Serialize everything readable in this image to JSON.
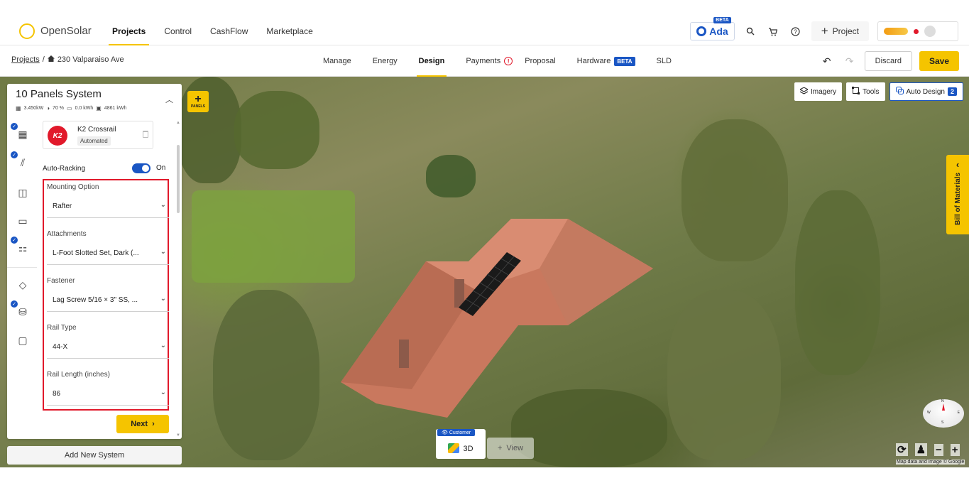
{
  "app": {
    "logo_text": "OpenSolar"
  },
  "topnav": {
    "items": [
      "Projects",
      "Control",
      "CashFlow",
      "Marketplace"
    ],
    "ada_label": "Ada",
    "ada_badge": "BETA",
    "project_button": "Project"
  },
  "subbar": {
    "breadcrumb_root": "Projects",
    "breadcrumb_separator": "/",
    "breadcrumb_project": "230 Valparaiso Ave",
    "tabs": [
      "Manage",
      "Energy",
      "Design",
      "Payments",
      "Proposal",
      "Hardware",
      "SLD"
    ],
    "hardware_badge": "BETA",
    "discard": "Discard",
    "save": "Save"
  },
  "system": {
    "title": "10 Panels System",
    "kw": "3.450",
    "kw_unit": "kW",
    "offset": "70",
    "offset_unit": "%",
    "battery": "0.0",
    "battery_unit": "kWh",
    "production": "4861",
    "production_unit": "kWh"
  },
  "racking": {
    "name": "K2 Crossrail",
    "tag": "Automated",
    "logo": "K2",
    "auto_label": "Auto-Racking",
    "auto_state": "On"
  },
  "options": [
    {
      "label": "Mounting Option",
      "value": "Rafter"
    },
    {
      "label": "Attachments",
      "value": "L-Foot Slotted Set, Dark (..."
    },
    {
      "label": "Fastener",
      "value": "Lag Screw 5/16 × 3\" SS, ..."
    },
    {
      "label": "Rail Type",
      "value": "44-X"
    },
    {
      "label": "Rail Length (inches)",
      "value": "86"
    }
  ],
  "next_button": "Next",
  "add_system": "Add New System",
  "map": {
    "add_panels_label": "PANELS",
    "imagery": "Imagery",
    "tools": "Tools",
    "auto_design": "Auto Design",
    "auto_design_count": "2",
    "bom_label": "Bill of Materials",
    "view_customer_tag": "Customer",
    "view_3d": "3D",
    "view_add": "View",
    "compass": {
      "n": "N",
      "s": "S",
      "e": "E",
      "w": "W"
    },
    "attribution": "Map data and image © Google"
  },
  "colors": {
    "accent": "#f5c400",
    "brand_blue": "#1a56c4",
    "highlight_red": "#e1192b"
  }
}
